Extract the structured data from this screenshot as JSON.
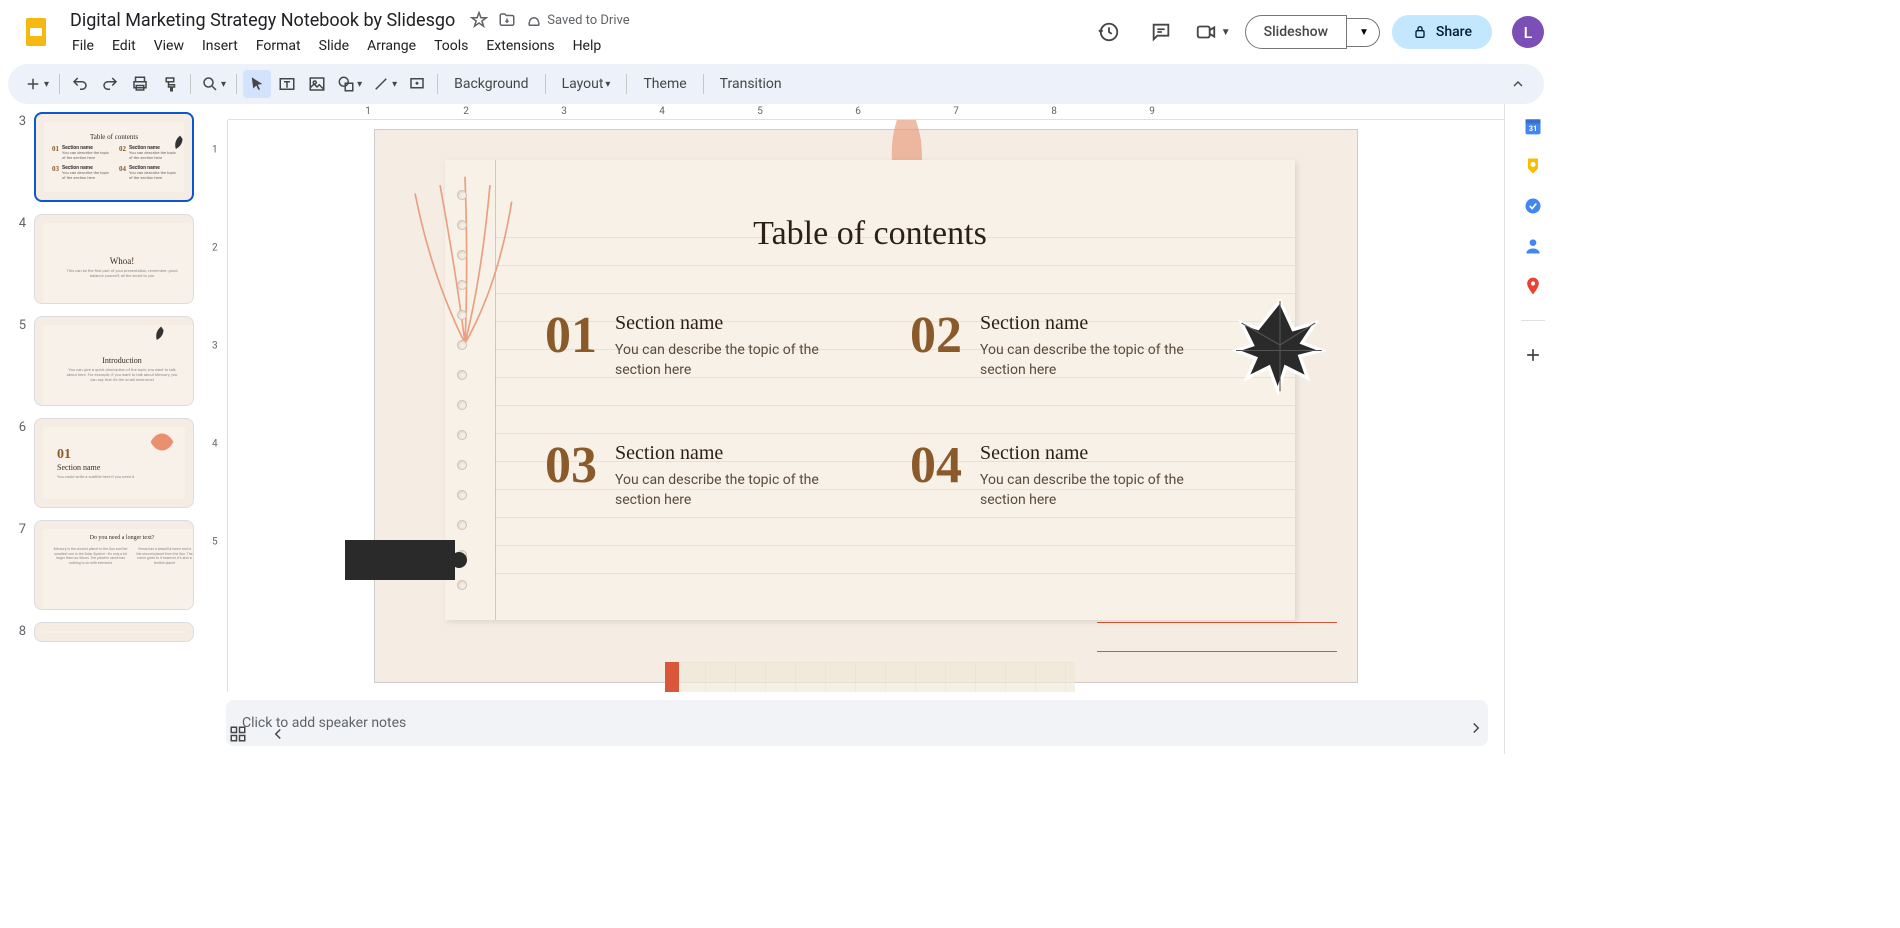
{
  "header": {
    "doc_title": "Digital Marketing Strategy Notebook by Slidesgo",
    "save_status": "Saved to Drive",
    "menus": [
      "File",
      "Edit",
      "View",
      "Insert",
      "Format",
      "Slide",
      "Arrange",
      "Tools",
      "Extensions",
      "Help"
    ],
    "slideshow_label": "Slideshow",
    "share_label": "Share",
    "avatar_letter": "L"
  },
  "toolbar": {
    "background": "Background",
    "layout": "Layout",
    "theme": "Theme",
    "transition": "Transition"
  },
  "filmstrip": {
    "slides": [
      {
        "num": "3",
        "active": true,
        "title": "Table of contents"
      },
      {
        "num": "4",
        "active": false,
        "title": "Whoa!"
      },
      {
        "num": "5",
        "active": false,
        "title": "Introduction"
      },
      {
        "num": "6",
        "active": false,
        "title": "Section name",
        "num_big": "01"
      },
      {
        "num": "7",
        "active": false,
        "title": "Do you need a longer text?"
      },
      {
        "num": "8",
        "active": false,
        "title": ""
      }
    ]
  },
  "slide": {
    "title": "Table of contents",
    "items": [
      {
        "num": "01",
        "title": "Section name",
        "desc": "You can describe the topic of the section here"
      },
      {
        "num": "02",
        "title": "Section name",
        "desc": "You can describe the topic of the section here"
      },
      {
        "num": "03",
        "title": "Section name",
        "desc": "You can describe the topic of the section here"
      },
      {
        "num": "04",
        "title": "Section name",
        "desc": "You can describe the topic of the section here"
      }
    ]
  },
  "ruler_h": [
    "1",
    "2",
    "3",
    "4",
    "5",
    "6",
    "7",
    "8",
    "9"
  ],
  "ruler_v": [
    "1",
    "2",
    "3",
    "4",
    "5"
  ],
  "speaker_notes_placeholder": "Click to add speaker notes"
}
